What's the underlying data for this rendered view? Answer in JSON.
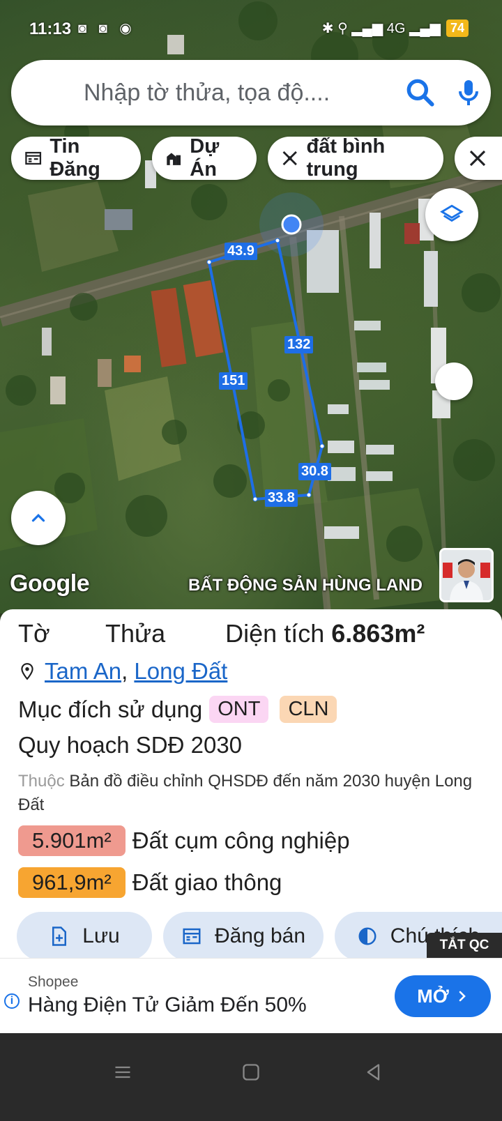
{
  "status_bar": {
    "time": "11:13",
    "notifications": "◙ ◙ ◉",
    "signals": "✱ ⚲ ▂▄▆ 4G ▂▄▆",
    "battery": "74"
  },
  "search": {
    "placeholder": "Nhập tờ thửa, tọa độ....",
    "search_icon": "search-icon",
    "mic_icon": "mic-icon"
  },
  "chips": [
    {
      "label": "Tin Đăng",
      "icon": "listing-icon"
    },
    {
      "label": "Dự Án",
      "icon": "building-icon"
    },
    {
      "label": "đất bình trung",
      "icon": "measure-icon"
    }
  ],
  "map": {
    "plot_labels": {
      "top": "43.9",
      "right": "132",
      "left": "151",
      "bottom_right": "30.8",
      "bottom": "33.8"
    },
    "google_logo": "Google",
    "watermark": "BẤT ĐỘNG SẢN HÙNG LAND",
    "colors": {
      "plot_line": "#1e6ee6",
      "location_dot": "#4285f4"
    }
  },
  "parcel": {
    "to_label": "Tờ",
    "thua_label": "Thửa",
    "area_label": "Diện tích",
    "area_value": "6.863m²",
    "location_ward": "Tam An",
    "location_separator": ",",
    "location_district": "Long Đất",
    "purpose_label": "Mục đích sử dụng",
    "purpose_tags": [
      "ONT",
      "CLN"
    ],
    "plan_title": "Quy hoạch SDĐ 2030",
    "plan_prefix": "Thuộc",
    "plan_desc": "Bản đồ điều chỉnh QHSDĐ đến năm 2030 huyện Long Đất",
    "zones": [
      {
        "area": "5.901m²",
        "label": "Đất cụm công nghiệp",
        "color": "#ef9a8f"
      },
      {
        "area": "961,9m²",
        "label": "Đất giao thông",
        "color": "#f7a531"
      }
    ]
  },
  "actions": [
    {
      "label": "Lưu",
      "icon": "save-file-icon"
    },
    {
      "label": "Đăng bán",
      "icon": "post-sale-icon"
    },
    {
      "label": "Chú thích",
      "icon": "legend-icon"
    }
  ],
  "ad": {
    "close_label": "TẮT QC",
    "brand": "Shopee",
    "headline": "Hàng Điện Tử Giảm Đến 50%",
    "cta": "MỞ",
    "cta_color": "#1a73e8"
  }
}
